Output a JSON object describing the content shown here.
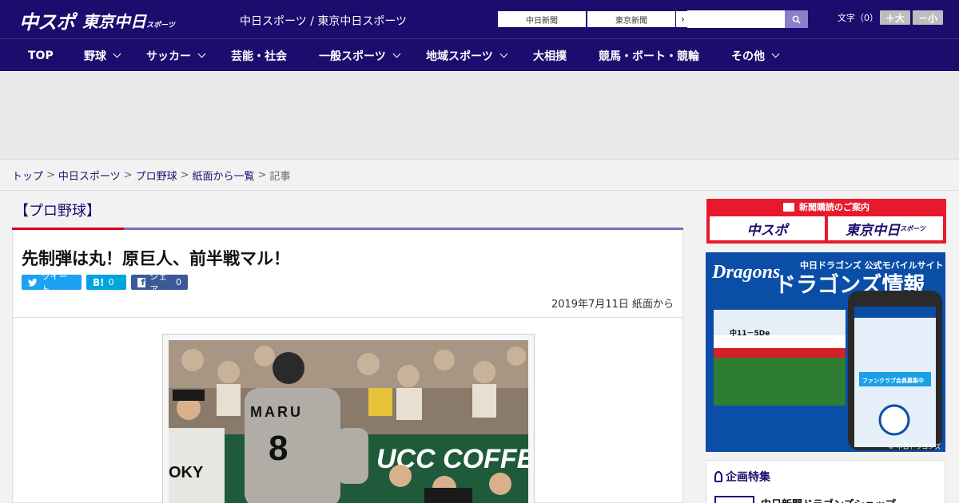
{
  "header": {
    "logo_main": "中スポ",
    "logo_sub": "東京中日",
    "logo_sub_small": "スポーツ",
    "site_links": "中日スポーツ / 東京中日スポーツ",
    "ext_links": [
      {
        "label": "中日新聞"
      },
      {
        "label": "東京新聞"
      }
    ],
    "search": {
      "placeholder": ""
    },
    "font_label": "文字（0）",
    "font_bigger": "＋大",
    "font_smaller": "－小"
  },
  "nav": {
    "items": [
      {
        "label": "TOP"
      },
      {
        "label": "野球"
      },
      {
        "label": "サッカー"
      },
      {
        "label": "芸能・社会"
      },
      {
        "label": "一般スポーツ"
      },
      {
        "label": "地域スポーツ"
      },
      {
        "label": "大相撲"
      },
      {
        "label": "競馬・ボート・競輪"
      },
      {
        "label": "その他"
      }
    ]
  },
  "breadcrumb": {
    "items": [
      "トップ",
      "中日スポーツ",
      "プロ野球",
      "紙面から一覧"
    ],
    "current": "記事",
    "separator": ">"
  },
  "article": {
    "category": "【プロ野球】",
    "headline": "先制弾は丸！原巨人、前半戦マル！",
    "share": {
      "tweet_label": "ツイート",
      "hatena_label": "B!",
      "hatena_count": "0",
      "facebook_label": "シェア",
      "facebook_count": "0"
    },
    "date": "2019年7月11日 紙面から",
    "photo": {
      "jersey_name": "MARU",
      "jersey_number": "8",
      "banner_text": "UCC COFFEE",
      "chest_text": "OKY"
    }
  },
  "sidebar": {
    "subscription_title": "新聞購読のご案内",
    "subscription_boxes": [
      "中スポ",
      "東京中日"
    ],
    "subscription_box_small": "スポーツ",
    "promo": {
      "brand": "Dragons",
      "tagline": "中日ドラゴンズ 公式モバイルサイト",
      "title": "ドラゴンズ情報",
      "score_line": "中11－5De",
      "phone_banner": "ファンクラブ会員募集中",
      "copyright": "© 中日ドラゴンズ"
    },
    "feature_title": "企画特集",
    "feature_item": "中日新聞ドラゴンズショップ"
  },
  "colors": {
    "brand_navy": "#1a0d6e",
    "accent_red": "#e8192c",
    "twitter": "#1da1f2",
    "hatena": "#00a4de",
    "facebook": "#3b5998"
  }
}
